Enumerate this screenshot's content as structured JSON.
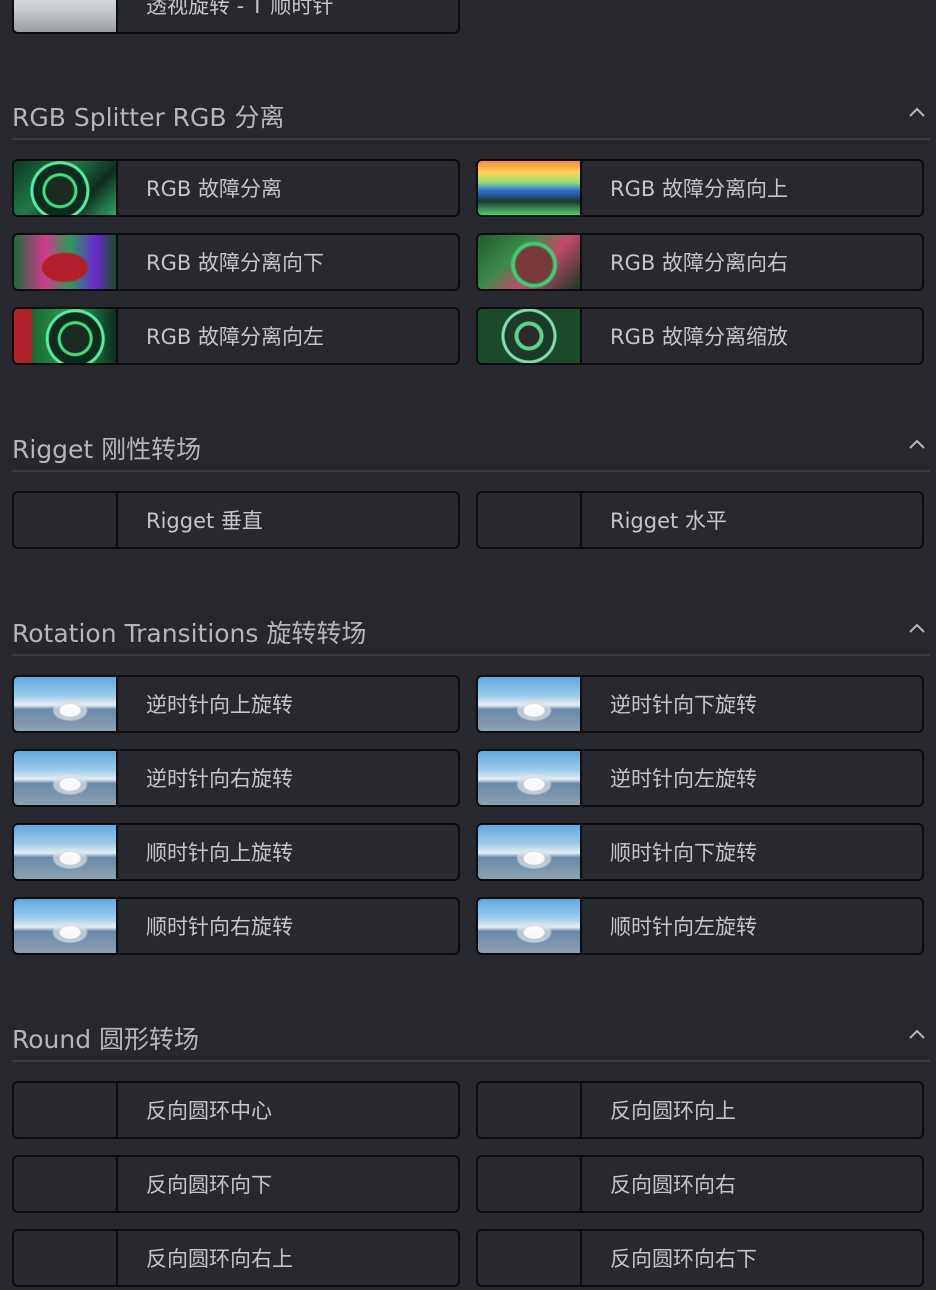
{
  "top_item": {
    "label": "透视旋转 - T 顺时针"
  },
  "sections": [
    {
      "title": "RGB Splitter RGB 分离",
      "items": [
        {
          "label": "RGB 故障分离"
        },
        {
          "label": "RGB 故障分离向上"
        },
        {
          "label": "RGB 故障分离向下"
        },
        {
          "label": "RGB 故障分离向右"
        },
        {
          "label": "RGB 故障分离向左"
        },
        {
          "label": "RGB 故障分离缩放"
        }
      ]
    },
    {
      "title": "Rigget 刚性转场",
      "items": [
        {
          "label": "Rigget 垂直"
        },
        {
          "label": "Rigget 水平"
        }
      ]
    },
    {
      "title": "Rotation Transitions 旋转转场",
      "items": [
        {
          "label": "逆时针向上旋转"
        },
        {
          "label": "逆时针向下旋转"
        },
        {
          "label": "逆时针向右旋转"
        },
        {
          "label": "逆时针向左旋转"
        },
        {
          "label": "顺时针向上旋转"
        },
        {
          "label": "顺时针向下旋转"
        },
        {
          "label": "顺时针向右旋转"
        },
        {
          "label": "顺时针向左旋转"
        }
      ]
    },
    {
      "title": "Round 圆形转场",
      "items": [
        {
          "label": "反向圆环中心"
        },
        {
          "label": "反向圆环向上"
        },
        {
          "label": "反向圆环向下"
        },
        {
          "label": "反向圆环向右"
        },
        {
          "label": "反向圆环向右上"
        },
        {
          "label": "反向圆环向右下"
        }
      ]
    }
  ],
  "icons": {
    "collapse": "chevron-up-icon"
  },
  "colors": {
    "background": "#27282d",
    "border": "#0c0c0e",
    "text": "#c4c5c9",
    "divider": "#3a3b40"
  }
}
